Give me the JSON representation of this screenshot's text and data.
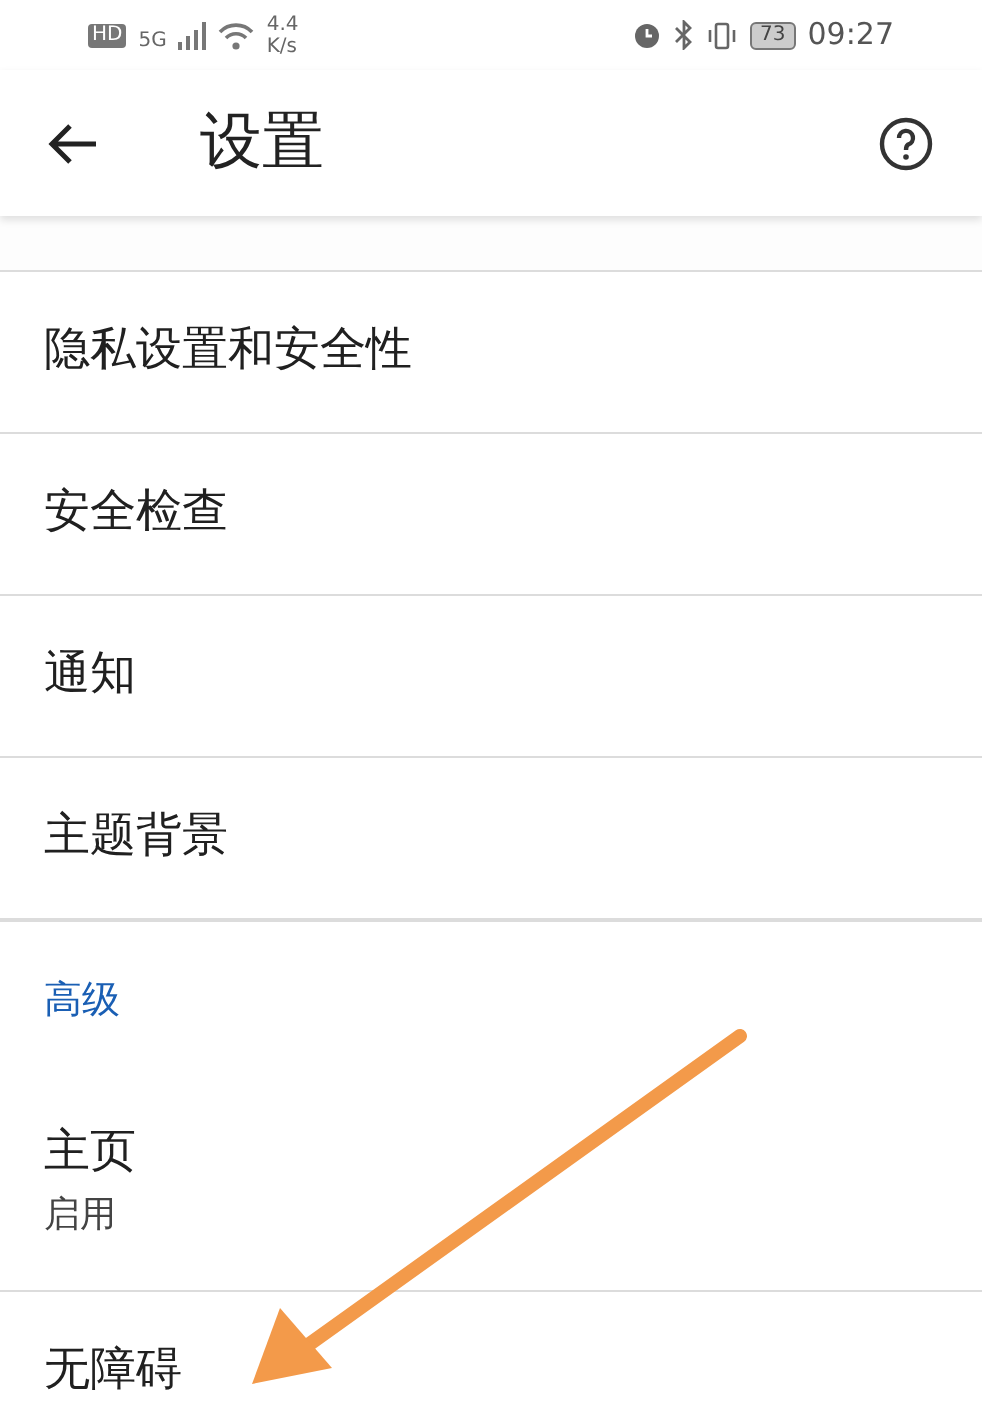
{
  "status_bar": {
    "hd": "HD",
    "network": "5G",
    "speed_value": "4.4",
    "speed_unit": "K/s",
    "battery": "73",
    "time": "09:27"
  },
  "header": {
    "title": "设置"
  },
  "items": [
    {
      "kind": "row",
      "title": "隐私设置和安全性"
    },
    {
      "kind": "row",
      "title": "安全检查"
    },
    {
      "kind": "row",
      "title": "通知"
    },
    {
      "kind": "row",
      "title": "主题背景"
    },
    {
      "kind": "section",
      "title": "高级"
    },
    {
      "kind": "row",
      "title": "主页",
      "subtitle": "启用"
    },
    {
      "kind": "row",
      "title": "无障碍"
    }
  ],
  "annotation": {
    "kind": "arrow"
  }
}
